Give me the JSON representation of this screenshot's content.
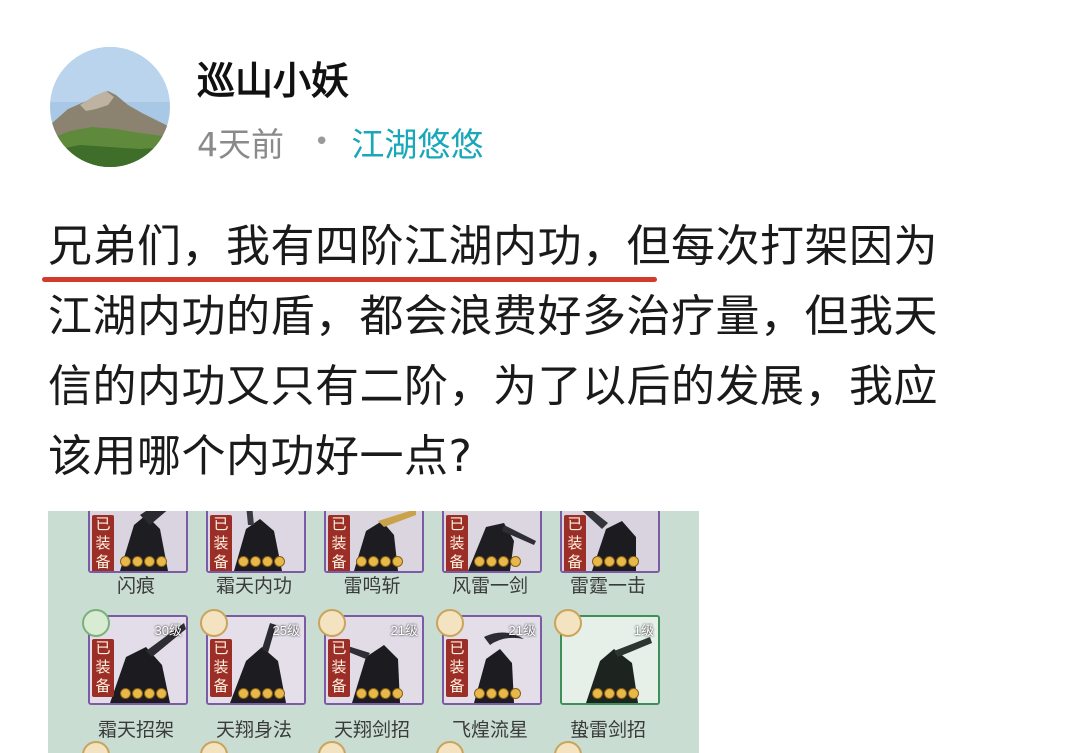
{
  "post": {
    "author": "巡山小妖",
    "time": "4天前",
    "separator": "•",
    "topic": "江湖悠悠",
    "text_lines": [
      "兄弟们，我有四阶江湖内功，但每次打架因为",
      "江湖内功的盾，都会浪费好多治疗量，但我天",
      "信的内功又只有二阶，为了以后的发展，我应",
      "该用哪个内功好一点?"
    ]
  },
  "game_screenshot": {
    "equipped_label": "已装备",
    "row1": [
      {
        "name": "闪痕",
        "equipped": true
      },
      {
        "name": "霜天内功",
        "equipped": true
      },
      {
        "name": "雷鸣斩",
        "equipped": true
      },
      {
        "name": "风雷一剑",
        "equipped": true
      },
      {
        "name": "雷霆一击",
        "equipped": true
      }
    ],
    "row2": [
      {
        "name": "霜天招架",
        "level": "30级",
        "equipped": true,
        "border": "purple",
        "badge": "green"
      },
      {
        "name": "天翔身法",
        "level": "25级",
        "equipped": true,
        "border": "purple",
        "badge": "gold"
      },
      {
        "name": "天翔剑招",
        "level": "21级",
        "equipped": true,
        "border": "purple",
        "badge": "gold"
      },
      {
        "name": "飞煌流星",
        "level": "21级",
        "equipped": true,
        "border": "purple",
        "badge": "gold"
      },
      {
        "name": "蛰雷剑招",
        "level": "1级",
        "equipped": false,
        "border": "green",
        "badge": "gold"
      }
    ]
  },
  "icons": {
    "avatar": "mountain-avatar",
    "badge": "skill-type-badge",
    "coin": "rank-coin-icon"
  },
  "colors": {
    "topic": "#19a7ba",
    "underline": "#d23a2b",
    "equip_tag": "#9c2e28",
    "panel_bg": "#c9ddd2"
  }
}
